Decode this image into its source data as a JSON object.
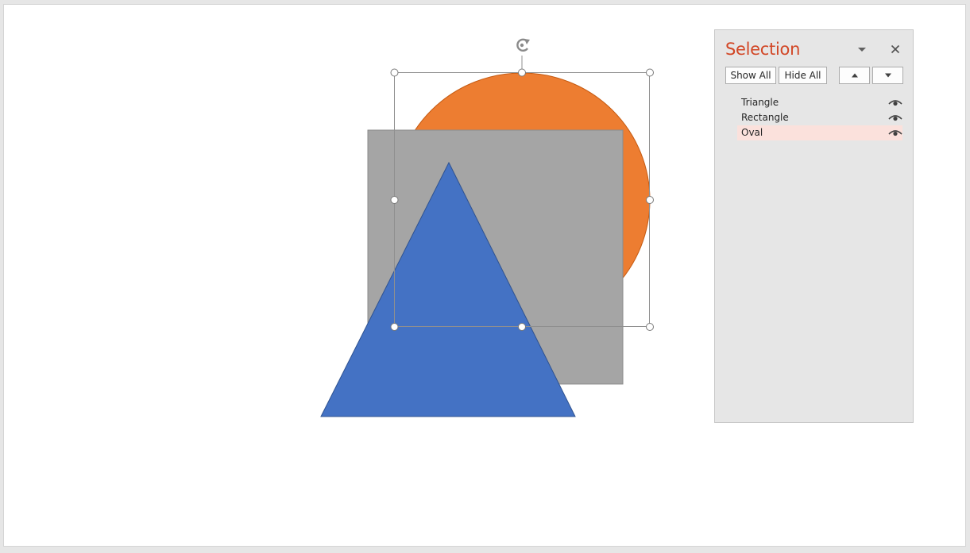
{
  "canvas": {
    "shapes": [
      {
        "name": "Oval",
        "type": "ellipse",
        "fill": "#ED7D31"
      },
      {
        "name": "Rectangle",
        "type": "rect",
        "fill": "#A5A5A5"
      },
      {
        "name": "Triangle",
        "type": "triangle",
        "fill": "#4472C4"
      }
    ],
    "selected_shape": "Oval"
  },
  "selection_pane": {
    "title": "Selection",
    "options_icon": "chevron-down-icon",
    "close_icon": "close-icon",
    "show_all_label": "Show All",
    "hide_all_label": "Hide All",
    "bring_forward_icon": "triangle-up-icon",
    "send_backward_icon": "triangle-down-icon",
    "items": [
      {
        "label": "Triangle",
        "visible_icon": "eye-icon",
        "selected": false
      },
      {
        "label": "Rectangle",
        "visible_icon": "eye-icon",
        "selected": false
      },
      {
        "label": "Oval",
        "visible_icon": "eye-icon",
        "selected": true
      }
    ]
  },
  "colors": {
    "title_accent": "#D24726",
    "selected_row": "#FBE1DC"
  }
}
